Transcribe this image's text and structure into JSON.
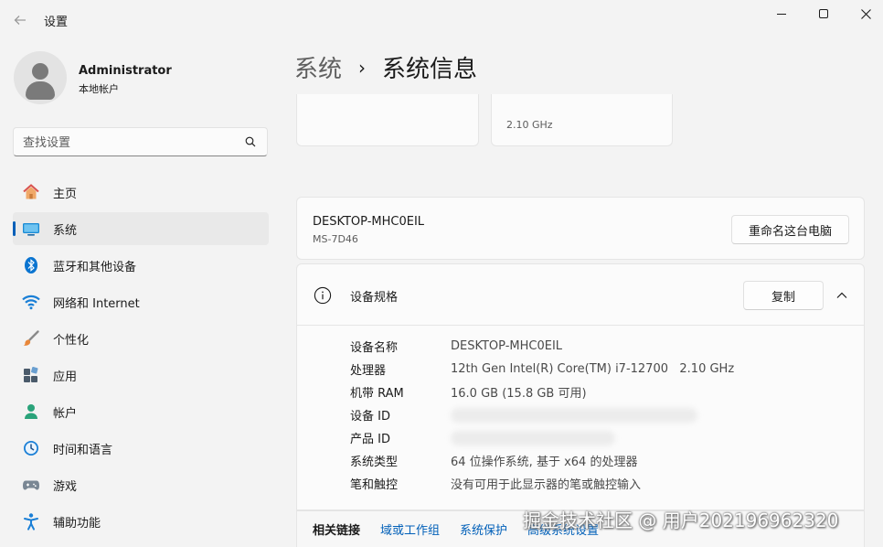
{
  "titlebar": {
    "app_title": "设置",
    "back_icon": "back-arrow-icon",
    "minimize_icon": "minimize-icon",
    "maximize_icon": "maximize-icon",
    "close_icon": "close-icon"
  },
  "account": {
    "name": "Administrator",
    "type": "本地帐户"
  },
  "search": {
    "placeholder": "查找设置"
  },
  "sidebar": {
    "items": [
      {
        "label": "主页",
        "icon": "home-icon"
      },
      {
        "label": "系统",
        "icon": "system-icon",
        "selected": true
      },
      {
        "label": "蓝牙和其他设备",
        "icon": "bluetooth-icon"
      },
      {
        "label": "网络和 Internet",
        "icon": "wifi-icon"
      },
      {
        "label": "个性化",
        "icon": "brush-icon"
      },
      {
        "label": "应用",
        "icon": "apps-icon"
      },
      {
        "label": "帐户",
        "icon": "account-icon"
      },
      {
        "label": "时间和语言",
        "icon": "clock-globe-icon"
      },
      {
        "label": "游戏",
        "icon": "gamepad-icon"
      },
      {
        "label": "辅助功能",
        "icon": "accessibility-icon"
      }
    ]
  },
  "breadcrumb": {
    "parent": "系统",
    "separator": "›",
    "current": "系统信息"
  },
  "top_cards": {
    "cpu_freq": "2.10 GHz"
  },
  "pc": {
    "name": "DESKTOP-MHC0EIL",
    "model": "MS-7D46",
    "rename_label": "重命名这台电脑"
  },
  "specs": {
    "title": "设备规格",
    "copy_label": "复制",
    "rows": [
      {
        "label": "设备名称",
        "value": "DESKTOP-MHC0EIL"
      },
      {
        "label": "处理器",
        "value": "12th Gen Intel(R) Core(TM) i7-12700   2.10 GHz"
      },
      {
        "label": "机带 RAM",
        "value": "16.0 GB (15.8 GB 可用)"
      },
      {
        "label": "设备 ID",
        "value": ""
      },
      {
        "label": "产品 ID",
        "value": ""
      },
      {
        "label": "系统类型",
        "value": "64 位操作系统, 基于 x64 的处理器"
      },
      {
        "label": "笔和触控",
        "value": "没有可用于此显示器的笔或触控输入"
      }
    ]
  },
  "related": {
    "title": "相关链接",
    "links": [
      "域或工作组",
      "系统保护",
      "高级系统设置"
    ]
  },
  "watermark": "掘金技术社区 @ 用户202196962320",
  "colors": {
    "accent": "#005fb8",
    "background": "#f3f3f3",
    "card": "#fbfbfb"
  }
}
